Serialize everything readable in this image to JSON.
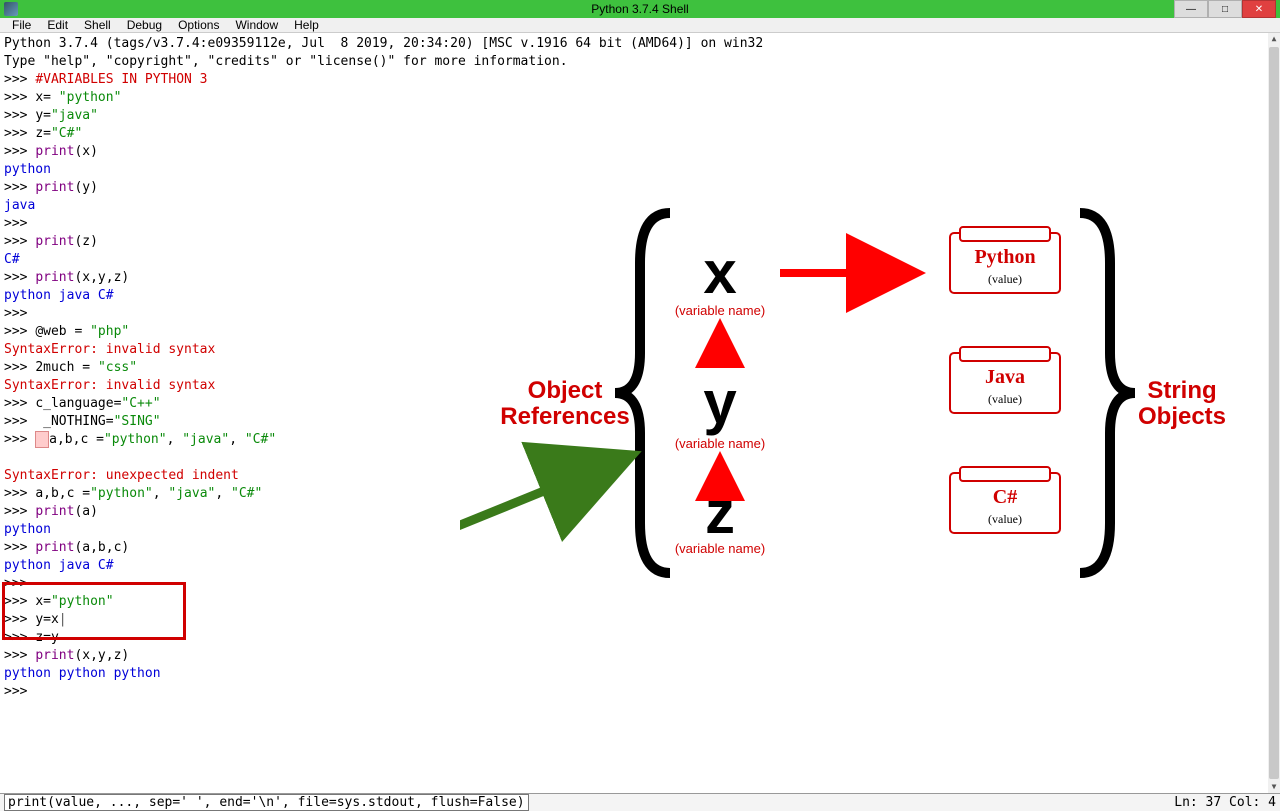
{
  "window": {
    "title": "Python 3.7.4 Shell"
  },
  "menu": {
    "file": "File",
    "edit": "Edit",
    "shell": "Shell",
    "debug": "Debug",
    "options": "Options",
    "window": "Window",
    "help": "Help"
  },
  "shell": {
    "banner1": "Python 3.7.4 (tags/v3.7.4:e09359112e, Jul  8 2019, 20:34:20) [MSC v.1916 64 bit (AMD64)] on win32",
    "banner2": "Type \"help\", \"copyright\", \"credits\" or \"license()\" for more information.",
    "comment": "#VARIABLES IN PYTHON 3",
    "l_x_assign_pre": "x= ",
    "l_x_assign_str": "\"python\"",
    "l_y_assign_pre": "y=",
    "l_y_assign_str": "\"java\"",
    "l_z_assign_pre": "z=",
    "l_z_assign_str": "\"C#\"",
    "l_printx_fn": "print",
    "l_printx_arg": "(x)",
    "out_python": "python",
    "l_printy_fn": "print",
    "l_printy_arg": "(y)",
    "out_java": "java",
    "l_printz_fn": "print",
    "l_printz_arg": "(z)",
    "out_csharp": "C#",
    "l_printxyz_fn": "print",
    "l_printxyz_arg": "(x,y,z)",
    "out_xyz": "python java C#",
    "l_atweb_pre": "@web = ",
    "l_atweb_str": "\"php\"",
    "err_syntax": "SyntaxError: invalid syntax",
    "l_2much_pre": "2much = ",
    "l_2much_str": "\"css\"",
    "l_clang_pre": "c_language=",
    "l_clang_str": "\"C++\"",
    "l_nothing_pre": " _NOTHING=",
    "l_nothing_str": "\"SING\"",
    "l_abc_indent_txt": "a,b,c =",
    "l_abc_indent_s1": "\"python\"",
    "l_abc_indent_c": ", ",
    "l_abc_indent_s2": "\"java\"",
    "l_abc_indent_s3": "\"C#\"",
    "err_indent": "SyntaxError: unexpected indent",
    "l_abc_ok_txt": "a,b,c =",
    "l_abc_ok_s1": "\"python\"",
    "l_abc_ok_s2": "\"java\"",
    "l_abc_ok_s3": "\"C#\"",
    "l_printa_fn": "print",
    "l_printa_arg": "(a)",
    "out_python2": "python",
    "l_printabc_fn": "print",
    "l_printabc_arg": "(a,b,c)",
    "out_abc": "python java C#",
    "alias_x_pre": "x=",
    "alias_x_str": "\"python\"",
    "alias_yx": "y=x",
    "alias_zy": "z=y",
    "l_printxyz2_fn": "print",
    "l_printxyz2_arg": "(x,y,z)",
    "out_ppp": "python python python",
    "cursor": "|"
  },
  "diagram": {
    "obj_refs_label": "Object\nReferences",
    "str_objs_label": "String\nObjects",
    "vars": [
      {
        "name": "x",
        "sub": "(variable name)"
      },
      {
        "name": "y",
        "sub": "(variable name)"
      },
      {
        "name": "z",
        "sub": "(variable name)"
      }
    ],
    "vals": [
      {
        "name": "Python",
        "sub": "(value)"
      },
      {
        "name": "Java",
        "sub": "(value)"
      },
      {
        "name": "C#",
        "sub": "(value)"
      }
    ]
  },
  "statusbar": {
    "tooltip": "print(value, ..., sep=' ', end='\\n', file=sys.stdout, flush=False)",
    "pos": "Ln: 37  Col: 4"
  }
}
